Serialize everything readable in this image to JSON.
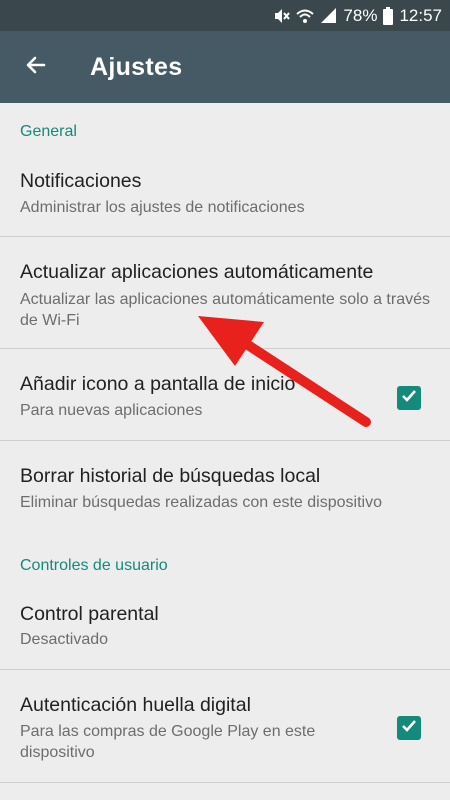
{
  "status_bar": {
    "battery": "78%",
    "time": "12:57",
    "icons": [
      "mute-icon",
      "wifi-icon",
      "signal-icon",
      "battery-icon"
    ]
  },
  "app_bar": {
    "title": "Ajustes",
    "back_icon": "arrow-back-icon"
  },
  "sections": [
    {
      "header": "General",
      "items": [
        {
          "title": "Notificaciones",
          "subtitle": "Administrar los ajustes de notificaciones"
        },
        {
          "title": "Actualizar aplicaciones automáticamente",
          "subtitle": "Actualizar las aplicaciones automáticamente solo a través de Wi-Fi"
        },
        {
          "title": "Añadir icono a pantalla de inicio",
          "subtitle": "Para nuevas aplicaciones",
          "checked": true
        },
        {
          "title": "Borrar historial de búsquedas  local",
          "subtitle": "Eliminar búsquedas realizadas con este dispositivo"
        }
      ]
    },
    {
      "header": "Controles de usuario",
      "items": [
        {
          "title": "Control parental",
          "subtitle": "Desactivado"
        },
        {
          "title": "Autenticación huella digital",
          "subtitle": "Para las compras de Google Play en este dispositivo",
          "checked": true
        }
      ]
    }
  ],
  "colors": {
    "status_bar": "#3a474d",
    "app_bar": "#455a64",
    "accent": "#138a7c",
    "background": "#ededed",
    "arrow": "#e8211c"
  }
}
